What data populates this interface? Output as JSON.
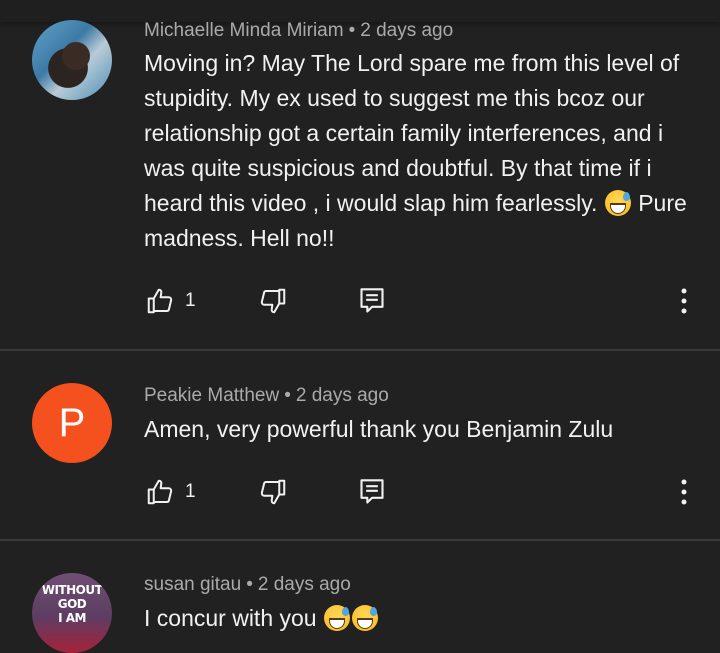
{
  "comments": [
    {
      "author": "Michaelle Minda Miriam",
      "time": "2 days ago",
      "avatar_icon": "profile-photo",
      "text": "Moving in? May The Lord spare me from this level of stupidity. My ex  used to suggest me this bcoz our relationship got a certain family interferences, and i was quite suspicious and doubtful. By that time if i heard this video , i would slap him fearlessly.",
      "text_after_emoji": "Pure madness. Hell no!!",
      "likes": "1"
    },
    {
      "author": "Peakie Matthew",
      "time": "2 days ago",
      "avatar_letter": "P",
      "avatar_color": "#f4511e",
      "text": "Amen, very powerful thank you Benjamin Zulu",
      "likes": "1"
    },
    {
      "author": "susan gitau",
      "time": "2 days ago",
      "avatar_text": [
        "WITHOUT",
        "GOD",
        "I AM"
      ],
      "text": "I concur with you"
    }
  ],
  "separator": "•",
  "colors": {
    "background": "#212121",
    "meta_text": "#aaaaaa",
    "body_text": "#f1f1f1",
    "divider": "#3a3a3a"
  }
}
